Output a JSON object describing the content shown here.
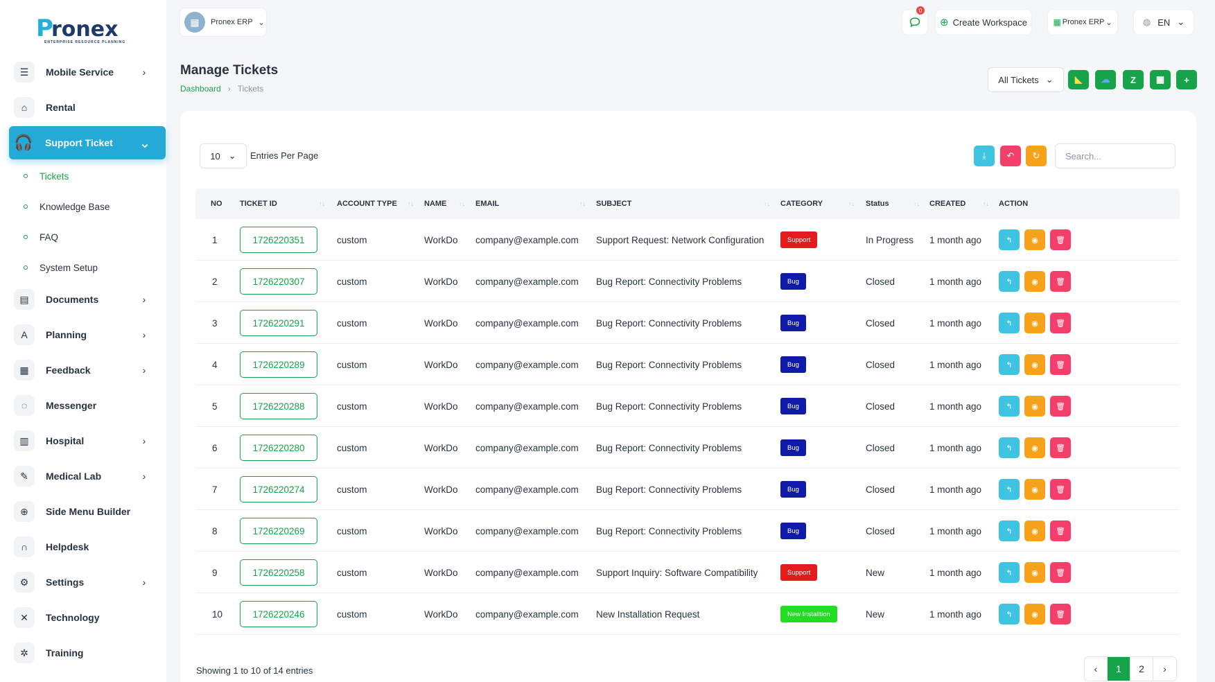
{
  "brand": {
    "logo_text": "Pronex",
    "logo_sub": "ENTERPRISE RESOURCE PLANNING"
  },
  "sidebar": {
    "items": [
      {
        "label": "Mobile Service",
        "icon": "menu-icon",
        "glyph": "☰",
        "chevron": true
      },
      {
        "label": "Rental",
        "icon": "home-icon",
        "glyph": "⌂",
        "chevron": false
      },
      {
        "label": "Support Ticket",
        "icon": "headset-icon",
        "glyph": "🎧",
        "chevron": true,
        "active": true
      },
      {
        "label": "Documents",
        "icon": "file-icon",
        "glyph": "▤",
        "chevron": true
      },
      {
        "label": "Planning",
        "icon": "planning-icon",
        "glyph": "A",
        "chevron": true
      },
      {
        "label": "Feedback",
        "icon": "clipboard-icon",
        "glyph": "▦",
        "chevron": true
      },
      {
        "label": "Messenger",
        "icon": "chat-icon",
        "glyph": "◌",
        "chevron": false
      },
      {
        "label": "Hospital",
        "icon": "building-icon",
        "glyph": "▥",
        "chevron": true
      },
      {
        "label": "Medical Lab",
        "icon": "pen-icon",
        "glyph": "✎",
        "chevron": true
      },
      {
        "label": "Side Menu Builder",
        "icon": "plus-circle-icon",
        "glyph": "⊕",
        "chevron": false
      },
      {
        "label": "Helpdesk",
        "icon": "headphones-icon",
        "glyph": "∩",
        "chevron": false
      },
      {
        "label": "Settings",
        "icon": "gear-icon",
        "glyph": "⚙",
        "chevron": true
      },
      {
        "label": "Technology",
        "icon": "tools-icon",
        "glyph": "✕",
        "chevron": false
      },
      {
        "label": "Training",
        "icon": "training-icon",
        "glyph": "✲",
        "chevron": false
      }
    ],
    "sub_items": [
      "Tickets",
      "Knowledge Base",
      "FAQ",
      "System Setup"
    ]
  },
  "header": {
    "workspace": "Pronex ERP",
    "notification_count": "0",
    "create_workspace": "Create Workspace",
    "erp_label": "Pronex ERP",
    "language": "EN"
  },
  "page": {
    "title": "Manage Tickets",
    "breadcrumb": [
      "Dashboard",
      "Tickets"
    ],
    "filter": "All Tickets"
  },
  "table_controls": {
    "per_page": "10",
    "per_page_label": "Entries Per Page",
    "search_placeholder": "Search..."
  },
  "table": {
    "columns": [
      "NO",
      "TICKET ID",
      "ACCOUNT TYPE",
      "NAME",
      "EMAIL",
      "SUBJECT",
      "CATEGORY",
      "Status",
      "CREATED",
      "ACTION"
    ],
    "rows": [
      {
        "no": "1",
        "ticket_id": "1726220351",
        "account_type": "custom",
        "name": "WorkDo",
        "email": "company@example.com",
        "subject": "Support Request: Network Configuration",
        "category": "Support",
        "status": "In Progress",
        "created": "1 month ago"
      },
      {
        "no": "2",
        "ticket_id": "1726220307",
        "account_type": "custom",
        "name": "WorkDo",
        "email": "company@example.com",
        "subject": "Bug Report: Connectivity Problems",
        "category": "Bug",
        "status": "Closed",
        "created": "1 month ago"
      },
      {
        "no": "3",
        "ticket_id": "1726220291",
        "account_type": "custom",
        "name": "WorkDo",
        "email": "company@example.com",
        "subject": "Bug Report: Connectivity Problems",
        "category": "Bug",
        "status": "Closed",
        "created": "1 month ago"
      },
      {
        "no": "4",
        "ticket_id": "1726220289",
        "account_type": "custom",
        "name": "WorkDo",
        "email": "company@example.com",
        "subject": "Bug Report: Connectivity Problems",
        "category": "Bug",
        "status": "Closed",
        "created": "1 month ago"
      },
      {
        "no": "5",
        "ticket_id": "1726220288",
        "account_type": "custom",
        "name": "WorkDo",
        "email": "company@example.com",
        "subject": "Bug Report: Connectivity Problems",
        "category": "Bug",
        "status": "Closed",
        "created": "1 month ago"
      },
      {
        "no": "6",
        "ticket_id": "1726220280",
        "account_type": "custom",
        "name": "WorkDo",
        "email": "company@example.com",
        "subject": "Bug Report: Connectivity Problems",
        "category": "Bug",
        "status": "Closed",
        "created": "1 month ago"
      },
      {
        "no": "7",
        "ticket_id": "1726220274",
        "account_type": "custom",
        "name": "WorkDo",
        "email": "company@example.com",
        "subject": "Bug Report: Connectivity Problems",
        "category": "Bug",
        "status": "Closed",
        "created": "1 month ago"
      },
      {
        "no": "8",
        "ticket_id": "1726220269",
        "account_type": "custom",
        "name": "WorkDo",
        "email": "company@example.com",
        "subject": "Bug Report: Connectivity Problems",
        "category": "Bug",
        "status": "Closed",
        "created": "1 month ago"
      },
      {
        "no": "9",
        "ticket_id": "1726220258",
        "account_type": "custom",
        "name": "WorkDo",
        "email": "company@example.com",
        "subject": "Support Inquiry: Software Compatibility",
        "category": "Support",
        "status": "New",
        "created": "1 month ago"
      },
      {
        "no": "10",
        "ticket_id": "1726220246",
        "account_type": "custom",
        "name": "WorkDo",
        "email": "company@example.com",
        "subject": "New Installation Request",
        "category": "New Installtion",
        "status": "New",
        "created": "1 month ago"
      }
    ]
  },
  "category_colors": {
    "Support": "#e11d1d",
    "Bug": "#0f1aa8",
    "New Installtion": "#22dd22"
  },
  "colors": {
    "primary": "#16a34a",
    "accent": "#25a9d6",
    "reply": "#3ec3e0",
    "view": "#f7a21b",
    "delete": "#f43f6b"
  },
  "footer": {
    "showing": "Showing 1 to 10 of 14 entries",
    "pages": [
      "1",
      "2"
    ],
    "current_page": "1"
  }
}
